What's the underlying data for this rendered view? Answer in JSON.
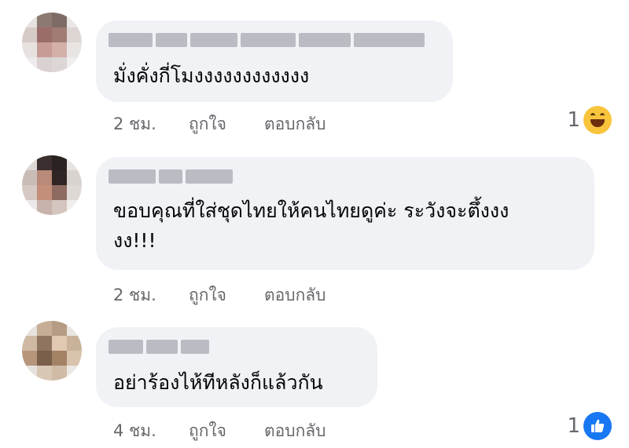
{
  "comments": [
    {
      "text": "มั่งคั่งกี่โมงงงงงงงงงงงง",
      "time": "2 ชม.",
      "like_label": "ถูกใจ",
      "reply_label": "ตอบกลับ",
      "reaction_count": "1",
      "reaction_icon": "haha-emoji-icon"
    },
    {
      "text": "ขอบคุณที่ใส่ชุดไทยให้คนไทยดูค่ะ ระวังจะตึ้งงง\nงง!!!",
      "time": "2 ชม.",
      "like_label": "ถูกใจ",
      "reply_label": "ตอบกลับ"
    },
    {
      "text": "อย่าร้องไห้ทีหลังก็แล้วกัน",
      "time": "4 ชม.",
      "like_label": "ถูกใจ",
      "reply_label": "ตอบกลับ",
      "reaction_count": "1",
      "reaction_icon": "like-thumb-icon"
    }
  ],
  "colors": {
    "bubble": "#f0f2f5",
    "meta_text": "#65676b",
    "like_blue": "#1877f2",
    "haha_yellow": "#f7c43c"
  }
}
